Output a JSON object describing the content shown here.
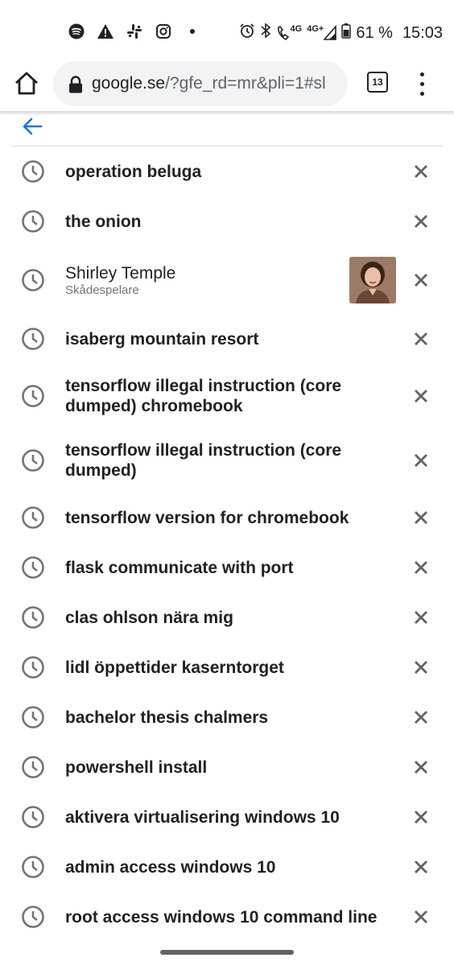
{
  "status_bar": {
    "left_icons": [
      "spotify-icon",
      "warning-icon",
      "slack-icon",
      "instagram-icon",
      "dot-icon"
    ],
    "network_4g": "4G",
    "network_4g_plus": "4G+",
    "battery": "61 %",
    "time": "15:03"
  },
  "toolbar": {
    "url_host": "google.se",
    "url_rest": "/?gfe_rd=mr&pli=1#sl",
    "tab_count": "13"
  },
  "suggestions": [
    {
      "query": "operation beluga",
      "bold": true
    },
    {
      "query": "the onion",
      "bold": true
    },
    {
      "query": "Shirley Temple",
      "subtitle": "Skådespelare",
      "bold": false,
      "has_thumbnail": true
    },
    {
      "query": "isaberg mountain resort",
      "bold": true
    },
    {
      "query": "tensorflow illegal instruction (core dumped) chromebook",
      "bold": true
    },
    {
      "query": "tensorflow illegal instruction (core dumped)",
      "bold": true
    },
    {
      "query": "tensorflow version for chromebook",
      "bold": true
    },
    {
      "query": "flask communicate with port",
      "bold": true
    },
    {
      "query": "clas ohlson nära mig",
      "bold": true
    },
    {
      "query": "lidl öppettider kaserntorget",
      "bold": true
    },
    {
      "query": "bachelor thesis chalmers",
      "bold": true
    },
    {
      "query": "powershell install",
      "bold": true
    },
    {
      "query": "aktivera virtualisering windows 10",
      "bold": true
    },
    {
      "query": "admin access windows 10",
      "bold": true
    },
    {
      "query": "root access windows 10 command line",
      "bold": true
    }
  ],
  "colors": {
    "accent": "#1a73e8",
    "icon_gray": "#5f6368",
    "text": "#202124",
    "subtext": "#70757a"
  }
}
